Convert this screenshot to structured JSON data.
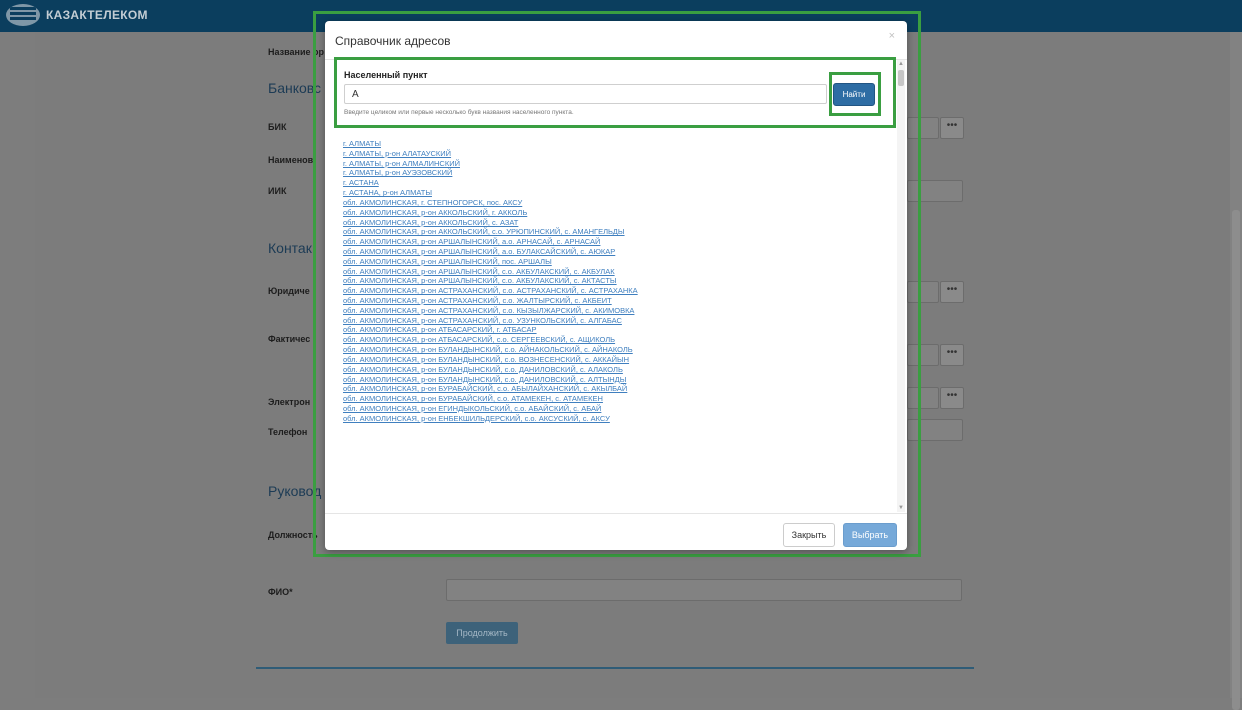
{
  "header": {
    "brand": "КАЗАКТЕЛЕКОМ"
  },
  "background_form": {
    "label_org_name": "Название ор",
    "section_bank": "Банковс",
    "label_bik": "БИК",
    "label_bank_name": "Наименов",
    "label_iik": "ИИК",
    "section_contacts": "Контак",
    "label_legal_address": "Юридиче",
    "label_actual_address": "Фактичес",
    "label_email": "Электрон",
    "label_phone": "Телефон",
    "section_management": "Руковод",
    "label_position": "Должность",
    "label_fio": "ФИО*",
    "dots": "•••",
    "continue_label": "Продолжить"
  },
  "modal": {
    "title": "Справочник адресов",
    "close_icon": "×",
    "field_label": "Населенный пункт",
    "search_value": "А",
    "help_text": "Введите целиком или первые несколько букв названия населенного пункта.",
    "find_label": "Найти",
    "close_label": "Закрыть",
    "select_label": "Выбрать",
    "results": [
      "г. АЛМАТЫ",
      "г. АЛМАТЫ, р-он АЛАТАУСКИЙ",
      "г. АЛМАТЫ, р-он АЛМАЛИНСКИЙ",
      "г. АЛМАТЫ, р-он АУЭЗОВСКИЙ",
      "г. АСТАНА",
      "г. АСТАНА, р-он АЛМАТЫ",
      "обл. АКМОЛИНСКАЯ, г. СТЕПНОГОРСК, пос. АКСУ",
      "обл. АКМОЛИНСКАЯ, р-он АККОЛЬСКИЙ, г. АККОЛЬ",
      "обл. АКМОЛИНСКАЯ, р-он АККОЛЬСКИЙ, с. АЗАТ",
      "обл. АКМОЛИНСКАЯ, р-он АККОЛЬСКИЙ, с.о. УРЮПИНСКИЙ, с. АМАНГЕЛЬДЫ",
      "обл. АКМОЛИНСКАЯ, р-он АРШАЛЫНСКИЙ, а.о. АРНАСАЙ, с. АРНАСАЙ",
      "обл. АКМОЛИНСКАЯ, р-он АРШАЛЫНСКИЙ, а.о. БУЛАКСАЙСКИЙ, с. АЮКАР",
      "обл. АКМОЛИНСКАЯ, р-он АРШАЛЫНСКИЙ, пос. АРШАЛЫ",
      "обл. АКМОЛИНСКАЯ, р-он АРШАЛЫНСКИЙ, с.о. АКБУЛАКСКИЙ, с. АКБУЛАК",
      "обл. АКМОЛИНСКАЯ, р-он АРШАЛЫНСКИЙ, с.о. АКБУЛАКСКИЙ, с. АКТАСТЫ",
      "обл. АКМОЛИНСКАЯ, р-он АСТРАХАНСКИЙ, с.о. АСТРАХАНСКИЙ, с. АСТРАХАНКА",
      "обл. АКМОЛИНСКАЯ, р-он АСТРАХАНСКИЙ, с.о. ЖАЛТЫРСКИЙ, с. АКБЕИТ",
      "обл. АКМОЛИНСКАЯ, р-он АСТРАХАНСКИЙ, с.о. КЫЗЫЛЖАРСКИЙ, с. АКИМОВКА",
      "обл. АКМОЛИНСКАЯ, р-он АСТРАХАНСКИЙ, с.о. УЗУНКОЛЬСКИЙ, с. АЛГАБАС",
      "обл. АКМОЛИНСКАЯ, р-он АТБАСАРСКИЙ, г. АТБАСАР",
      "обл. АКМОЛИНСКАЯ, р-он АТБАСАРСКИЙ, с.о. СЕРГЕЕВСКИЙ, с. АЩИКОЛЬ",
      "обл. АКМОЛИНСКАЯ, р-он БУЛАНДЫНСКИЙ, с.о. АЙНАКОЛЬСКИЙ, с. АЙНАКОЛЬ",
      "обл. АКМОЛИНСКАЯ, р-он БУЛАНДЫНСКИЙ, с.о. ВОЗНЕСЕНСКИЙ, с. АККАЙЫН",
      "обл. АКМОЛИНСКАЯ, р-он БУЛАНДЫНСКИЙ, с.о. ДАНИЛОВСКИЙ, с. АЛАКОЛЬ",
      "обл. АКМОЛИНСКАЯ, р-он БУЛАНДЫНСКИЙ, с.о. ДАНИЛОВСКИЙ, с. АЛТЫНДЫ",
      "обл. АКМОЛИНСКАЯ, р-он БУРАБАЙСКИЙ, с.о. АБЫЛАЙХАНСКИЙ, с. АКЫЛБАЙ",
      "обл. АКМОЛИНСКАЯ, р-он БУРАБАЙСКИЙ, с.о. АТАМЕКЕН, с. АТАМЕКЕН",
      "обл. АКМОЛИНСКАЯ, р-он ЕГИНДЫКОЛЬСКИЙ, с.о. АБАЙСКИЙ, с. АБАЙ",
      "обл. АКМОЛИНСКАЯ, р-он ЕНБЕКШИЛЬДЕРСКИЙ, с.о. АКСУСКИЙ, с. АКСУ"
    ]
  }
}
